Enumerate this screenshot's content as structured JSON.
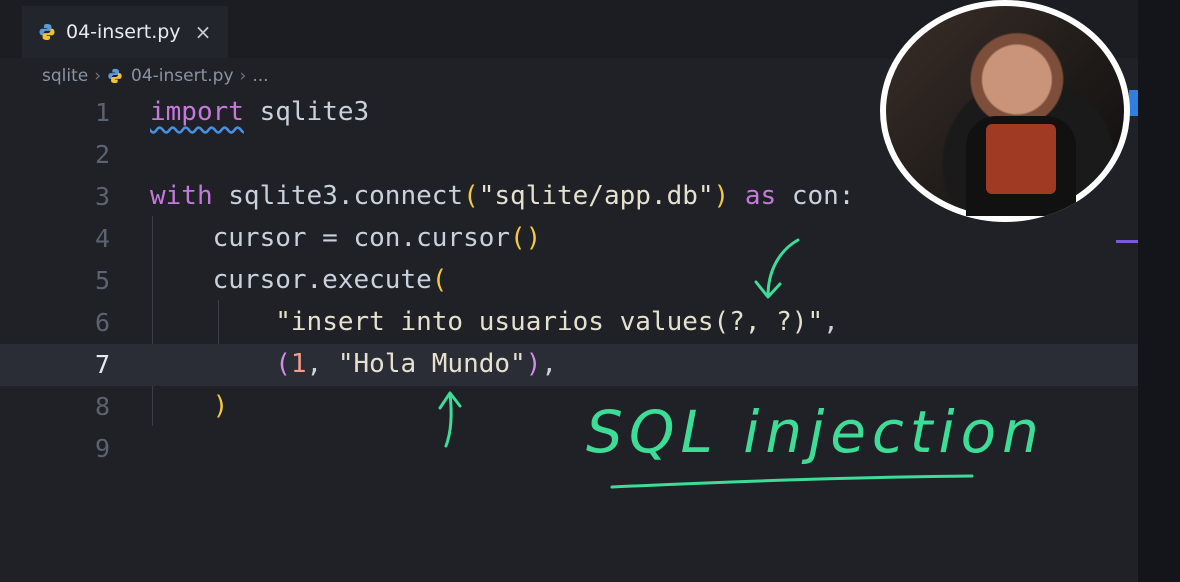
{
  "tab": {
    "title": "04-insert.py",
    "close": "×"
  },
  "breadcrumb": {
    "folder": "sqlite",
    "file": "04-insert.py",
    "more": "..."
  },
  "code": {
    "lines": [
      {
        "n": "1",
        "text": "import sqlite3"
      },
      {
        "n": "2",
        "text": ""
      },
      {
        "n": "3",
        "text": "with sqlite3.connect(\"sqlite/app.db\") as con:"
      },
      {
        "n": "4",
        "text": "    cursor = con.cursor()"
      },
      {
        "n": "5",
        "text": "    cursor.execute("
      },
      {
        "n": "6",
        "text": "        \"insert into usuarios values(?, ?)\","
      },
      {
        "n": "7",
        "text": "        (1, \"Hola Mundo\"),"
      },
      {
        "n": "8",
        "text": "    )"
      },
      {
        "n": "9",
        "text": ""
      }
    ],
    "current_line": "7"
  },
  "annotation": {
    "text": "SQL injection"
  },
  "colors": {
    "background": "#1f2127",
    "keyword": "#c678dd",
    "paren": "#f5c942",
    "annotation": "#3ddc97"
  }
}
